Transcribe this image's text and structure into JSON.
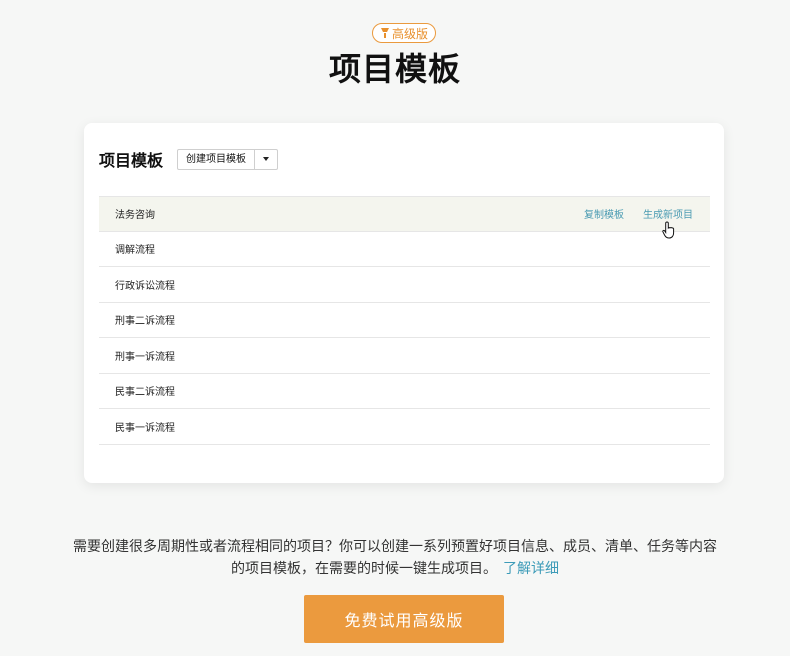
{
  "badge": {
    "icon": "premium-icon",
    "label": "高级版",
    "color": "#e8902d"
  },
  "page": {
    "title": "项目模板"
  },
  "card": {
    "title": "项目模板",
    "create_button": {
      "label": "创建项目模板",
      "caret_icon": "chevron-down-icon"
    },
    "templates": [
      {
        "name": "法务咨询",
        "actions": [
          "复制模板",
          "生成新项目"
        ]
      },
      {
        "name": "调解流程"
      },
      {
        "name": "行政诉讼流程"
      },
      {
        "name": "刑事二诉流程"
      },
      {
        "name": "刑事一诉流程"
      },
      {
        "name": "民事二诉流程"
      },
      {
        "name": "民事一诉流程"
      }
    ]
  },
  "description": {
    "text": "需要创建很多周期性或者流程相同的项目？你可以创建一系列预置好项目信息、成员、清单、任务等内容的项目模板，在需要的时候一键生成项目。",
    "link": "了解详细",
    "link_color": "#3c9bb8"
  },
  "cta": {
    "label": "免费试用高级版",
    "color": "#eb9a3e"
  }
}
